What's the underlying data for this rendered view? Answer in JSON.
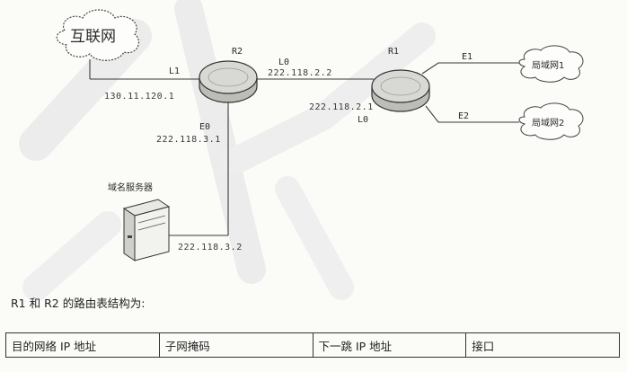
{
  "diagram": {
    "internet_cloud": "互联网",
    "routers": {
      "r2": "R2",
      "r1": "R1"
    },
    "interfaces": {
      "r2_l1": "L1",
      "r2_l0": "L0",
      "r2_e0": "E0",
      "r1_l0": "L0",
      "r1_e1": "E1",
      "r1_e2": "E2"
    },
    "addresses": {
      "r2_l1_ip": "130.11.120.1",
      "r2_l0_ip": "222.118.2.2",
      "r1_l0_ip": "222.118.2.1",
      "r2_e0_ip": "222.118.3.1",
      "server_ip": "222.118.3.2"
    },
    "lans": {
      "lan1": "局域网1",
      "lan2": "局域网2"
    },
    "server_label": "域名服务器"
  },
  "caption": "R1 和 R2 的路由表结构为:",
  "route_table": {
    "headers": [
      "目的网络 IP 地址",
      "子网掩码",
      "下一跳 IP 地址",
      "接口"
    ]
  },
  "colors": {
    "line": "#3a3a3a",
    "router_fill": "#d8d8d4",
    "watermark": "#e9e9e9"
  }
}
